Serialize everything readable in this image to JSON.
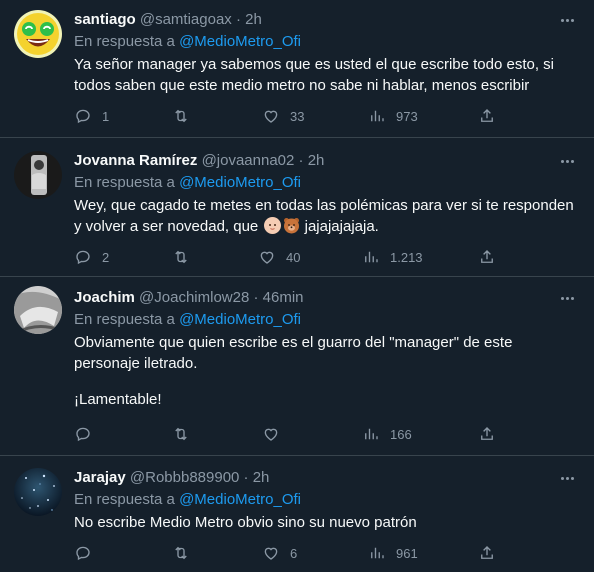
{
  "reply_prefix": "En respuesta a",
  "tweets": [
    {
      "name": "santiago",
      "handle": "@samtiagoax",
      "time": "2h",
      "reply_to": "@MedioMetro_Ofi",
      "text": "Ya señor manager ya sabemos que es usted el que escribe todo esto, si todos saben que este medio metro no sabe ni hablar, menos escribir",
      "replies": "1",
      "retweets": "",
      "likes": "33",
      "views": "973",
      "avatar_icon": "laughing-emoji-avatar-icon"
    },
    {
      "name": "Jovanna Ramírez",
      "handle": "@jovaanna02",
      "time": "2h",
      "reply_to": "@MedioMetro_Ofi",
      "text": "Wey, que cagado te metes en todas las polémicas para ver si te responden y volver a ser novedad, que",
      "text_tail": "jajajajajaja.",
      "replies": "2",
      "retweets": "",
      "likes": "40",
      "views": "1.213",
      "avatar_icon": "profile-photo-avatar-icon",
      "emojis": [
        "baby-face-emoji",
        "bear-face-emoji"
      ]
    },
    {
      "name": "Joachim",
      "handle": "@Joachimlow28",
      "time": "46min",
      "reply_to": "@MedioMetro_Ofi",
      "text": "Obviamente que quien escribe es el guarro del \"manager\" de este personaje iletrado.",
      "text2": "¡Lamentable!",
      "replies": "",
      "retweets": "",
      "likes": "",
      "views": "166",
      "avatar_icon": "profile-photo-avatar-icon"
    },
    {
      "name": "Jarajay",
      "handle": "@Robbb889900",
      "time": "2h",
      "reply_to": "@MedioMetro_Ofi",
      "text": "No escribe Medio Metro obvio sino su nuevo patrón",
      "replies": "",
      "retweets": "",
      "likes": "6",
      "views": "961",
      "avatar_icon": "night-sky-avatar-icon"
    }
  ],
  "colors": {
    "background": "#15202b",
    "primary_text": "#f7f9f9",
    "secondary_text": "#8b98a5",
    "link": "#1d9bf0",
    "divider": "#38444d"
  }
}
